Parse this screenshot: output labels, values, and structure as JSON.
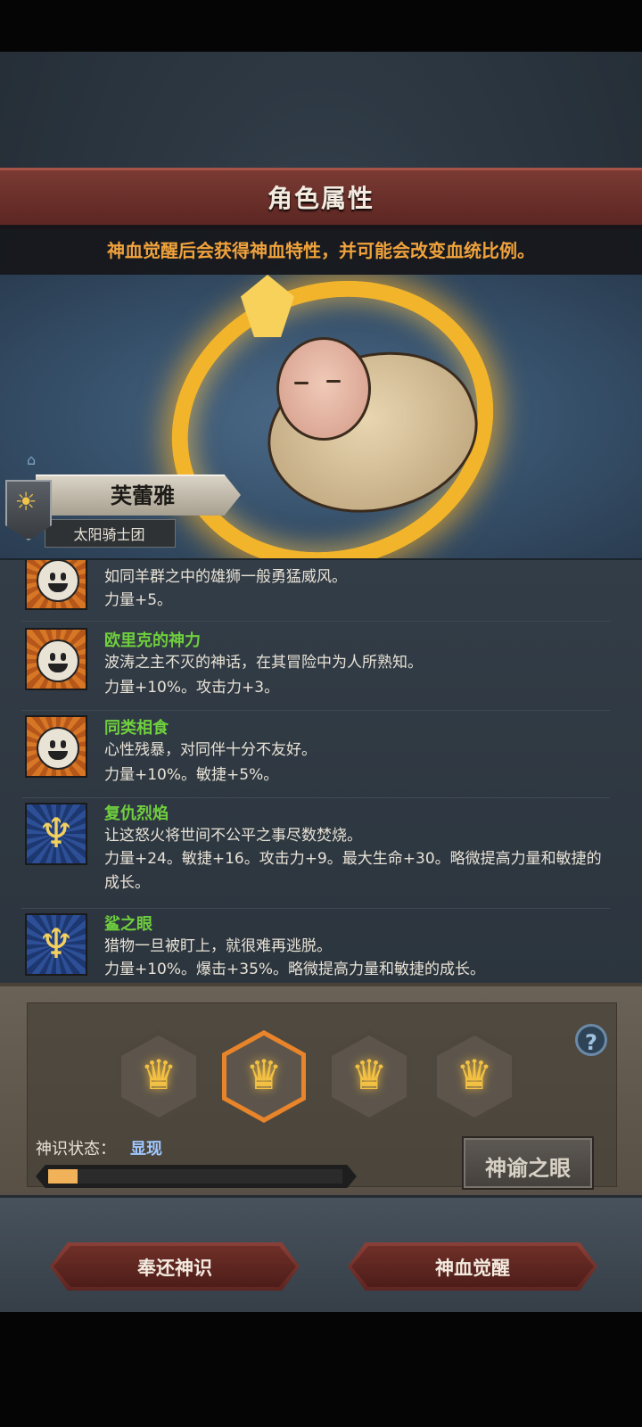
{
  "header": {
    "title": "角色属性",
    "subtitle": "神血觉醒后会获得神血特性，并可能会改变血统比例。"
  },
  "character": {
    "name": "芙蕾雅",
    "guild": "太阳骑士团"
  },
  "traits": [
    {
      "name": "",
      "icon": "smile-icon",
      "desc": "如同羊群之中的雄狮一般勇猛威风。",
      "stats": "力量+5。"
    },
    {
      "name": "欧里克的神力",
      "icon": "smile-icon",
      "desc": "波涛之主不灭的神话，在其冒险中为人所熟知。",
      "stats": "力量+10%。攻击力+3。"
    },
    {
      "name": "同类相食",
      "icon": "smile-icon",
      "desc": "心性残暴，对同伴十分不友好。",
      "stats": "力量+10%。敏捷+5%。"
    },
    {
      "name": "复仇烈焰",
      "icon": "axe-icon",
      "desc": "让这怒火将世间不公平之事尽数焚烧。",
      "stats": "力量+24。敏捷+16。攻击力+9。最大生命+30。略微提高力量和敏捷的成长。"
    },
    {
      "name": "鲨之眼",
      "icon": "axe-icon",
      "desc": "猎物一旦被盯上，就很难再逃脱。",
      "stats": "力量+10%。爆击+35%。略微提高力量和敏捷的成长。"
    }
  ],
  "awaken": {
    "status_label": "神识状态：",
    "status_value": "显现",
    "progress_fraction": 0.1,
    "oracle_button": "神谕之眼",
    "help": "?"
  },
  "buttons": {
    "return": "奉还神识",
    "awaken": "神血觉醒"
  },
  "colors": {
    "accent": "#f0a23c",
    "trait_name": "#6fcf3e",
    "status_value": "#9fc8ff"
  }
}
